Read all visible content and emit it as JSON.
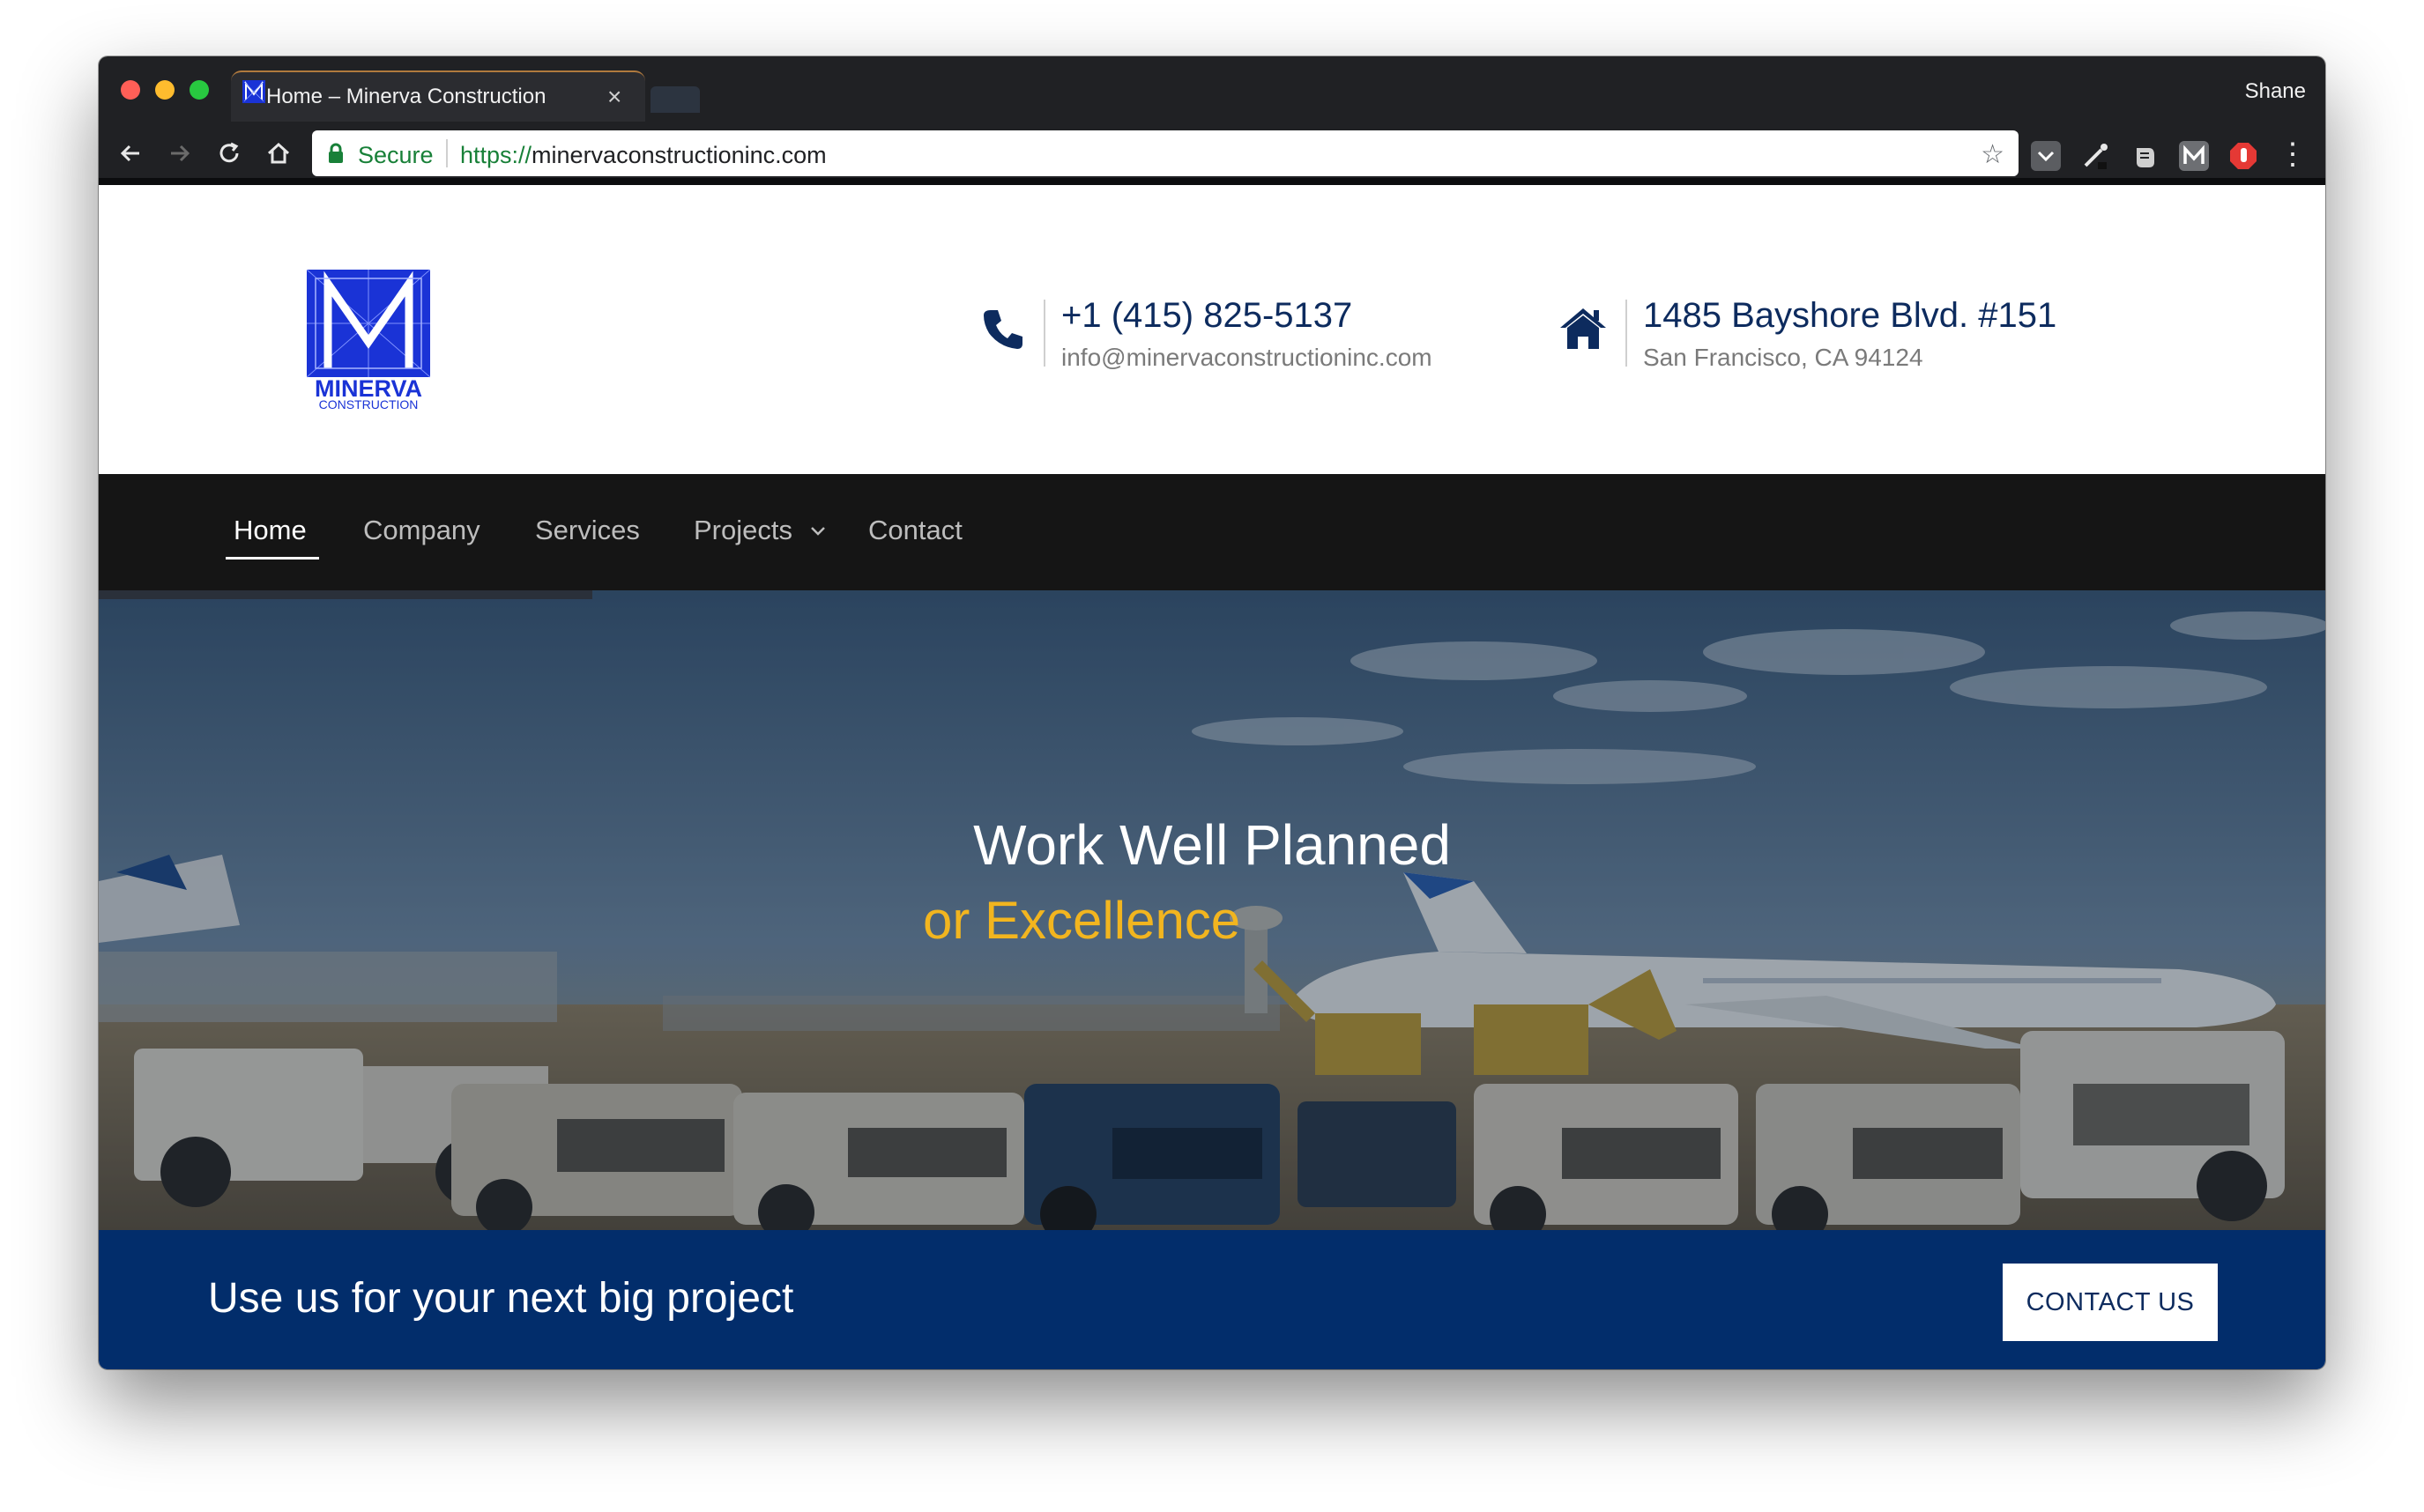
{
  "browser": {
    "tab_title": "Home – Minerva Construction",
    "profile_name": "Shane",
    "secure_label": "Secure",
    "url_scheme": "https://",
    "url_host": "minervaconstructioninc.com",
    "favicon_icon": "minerva-logo-icon",
    "extensions": [
      "pocket-icon",
      "color-picker-icon",
      "evernote-icon",
      "m-extension-icon",
      "adblock-icon"
    ]
  },
  "site": {
    "logo": {
      "name": "MINERVA",
      "tagline": "CONSTRUCTION",
      "color": "#1a33d6"
    },
    "phone": {
      "number": "+1 (415) 825-5137",
      "email": "info@minervaconstructioninc.com",
      "icon": "phone-icon"
    },
    "address": {
      "line1": "1485 Bayshore Blvd. #151",
      "line2": "San Francisco, CA 94124",
      "icon": "home-icon"
    },
    "nav": {
      "items": [
        {
          "label": "Home",
          "active": true
        },
        {
          "label": "Company"
        },
        {
          "label": "Services"
        },
        {
          "label": "Projects",
          "has_dropdown": true
        },
        {
          "label": "Contact"
        }
      ]
    },
    "hero": {
      "title": "Work Well Planned",
      "subtitle": "or Excellence"
    },
    "cta": {
      "text": "Use us for your next big project",
      "button": "CONTACT US"
    },
    "colors": {
      "brand_navy": "#022d6b",
      "accent_gold": "#f2b51f",
      "nav_bg": "#151515"
    }
  }
}
